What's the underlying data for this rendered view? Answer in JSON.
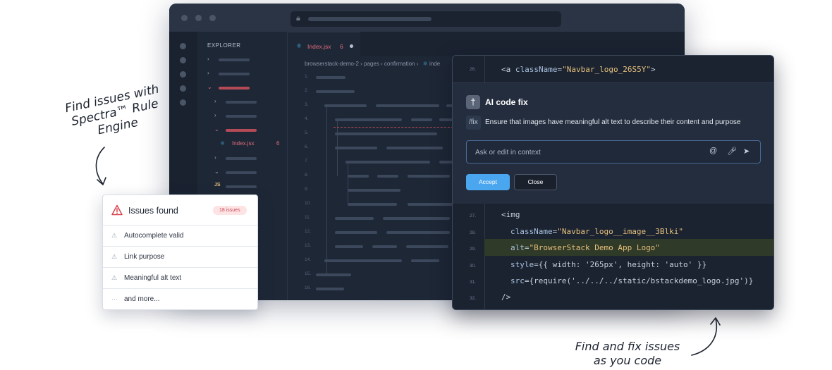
{
  "editor": {
    "explorer_header": "EXPLORER",
    "explorer_file": "Index.jsx",
    "explorer_file_count": "6",
    "js_icon": "JS",
    "tab_name": "Index.jsx",
    "tab_count": "6",
    "breadcrumb": "browserstack-demo-2 › pages › confirmation ›",
    "breadcrumb_tail": "inde",
    "line_numbers": [
      "1.",
      "2.",
      "3.",
      "4.",
      "5.",
      "6.",
      "7.",
      "8.",
      "9.",
      "10.",
      "11.",
      "12.",
      "13.",
      "14.",
      "15.",
      "16."
    ]
  },
  "ai_fix": {
    "top_line_number": "26.",
    "top_line_tag": "<a",
    "top_line_attr": "className",
    "top_line_value": "\"Navbar_logo_26S5Y\"",
    "top_line_close": ">",
    "title": "AI code fix",
    "command": "/fix",
    "description": "Ensure that images have meaningful alt text to describe their content and purpose",
    "input_placeholder": "Ask or edit in context",
    "accept_label": "Accept",
    "close_label": "Close",
    "code_lines": [
      {
        "n": "27.",
        "text": "<img"
      },
      {
        "n": "28.",
        "attr": "className",
        "value": "\"Navbar_logo__image__3Blki\""
      },
      {
        "n": "29.",
        "attr": "alt",
        "value": "\"BrowserStack Demo App Logo\""
      },
      {
        "n": "30.",
        "attr": "style",
        "value": "{{ width: '265px', height: 'auto' }}"
      },
      {
        "n": "31.",
        "attr": "src",
        "value": "{require('../../../static/bstackdemo_logo.jpg')}"
      },
      {
        "n": "32.",
        "text": "/>"
      }
    ]
  },
  "issues": {
    "title": "Issues found",
    "badge": "18 issues",
    "items": [
      {
        "icon": "warning-icon",
        "label": "Autocomplete valid"
      },
      {
        "icon": "warning-icon",
        "label": "Link purpose"
      },
      {
        "icon": "warning-icon",
        "label": "Meaningful alt text"
      },
      {
        "icon": "more-icon",
        "label": "and more..."
      }
    ]
  },
  "annotations": {
    "left_line1": "Find issues with",
    "left_line2": "Spectra™ Rule",
    "left_line3": "Engine",
    "right_line1": "Find and fix issues",
    "right_line2": "as you code"
  },
  "colors": {
    "editor_bg": "#1e2736",
    "accent_blue": "#4aa6ef",
    "error_red": "#e06c7a",
    "highlight_line": "#303a28",
    "string_yellow": "#e5c07b"
  }
}
